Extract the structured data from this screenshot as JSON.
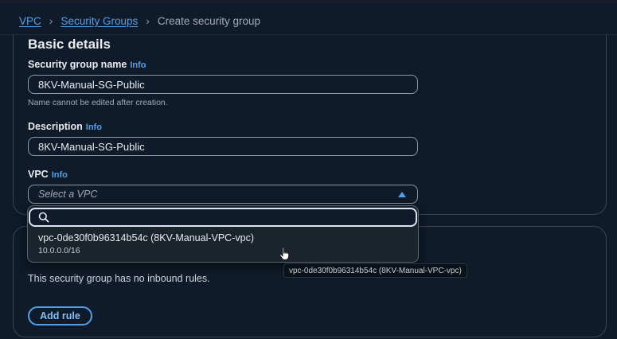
{
  "breadcrumb": {
    "items": [
      "VPC",
      "Security Groups"
    ],
    "current": "Create security group"
  },
  "basic_details": {
    "title": "Basic details",
    "name_label": "Security group name",
    "name_info": "Info",
    "name_value": "8KV-Manual-SG-Public",
    "name_hint": "Name cannot be edited after creation.",
    "description_label": "Description",
    "description_info": "Info",
    "description_value": "8KV-Manual-SG-Public",
    "vpc_label": "VPC",
    "vpc_info": "Info",
    "vpc_placeholder": "Select a VPC"
  },
  "vpc_dropdown": {
    "search_value": "",
    "options": [
      {
        "label": "vpc-0de30f0b96314b54c (8KV-Manual-VPC-vpc)",
        "cidr": "10.0.0.0/16"
      }
    ],
    "tooltip": "vpc-0de30f0b96314b54c (8KV-Manual-VPC-vpc)"
  },
  "inbound": {
    "empty_text": "This security group has no inbound rules.",
    "add_rule_label": "Add rule"
  },
  "colors": {
    "background": "#0f1b2a",
    "link": "#539fe5",
    "border": "#8d99a8"
  }
}
